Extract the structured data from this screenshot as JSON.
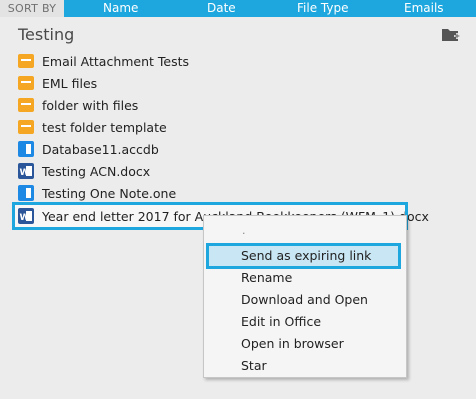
{
  "sort_bar": {
    "label": "SORT BY",
    "columns": [
      "Name",
      "Date",
      "File Type",
      "Emails"
    ]
  },
  "folder": {
    "title": "Testing",
    "new_folder_icon": "new-folder-icon"
  },
  "items": [
    {
      "name": "Email Attachment Tests",
      "type": "folder"
    },
    {
      "name": "EML files",
      "type": "folder"
    },
    {
      "name": "folder with files",
      "type": "folder"
    },
    {
      "name": "test folder template",
      "type": "folder"
    },
    {
      "name": "Database11.accdb",
      "type": "generic-file"
    },
    {
      "name": "Testing ACN.docx",
      "type": "word-file"
    },
    {
      "name": "Testing One Note.one",
      "type": "generic-file"
    },
    {
      "name": "Year end letter 2017 for Auckland Bookkeepers (WFM_1).docx",
      "type": "word-file",
      "selected": true
    }
  ],
  "context_menu": {
    "overflow": ".",
    "items": [
      {
        "label": "Send as expiring link",
        "highlighted": true
      },
      {
        "label": "Rename"
      },
      {
        "label": "Download and Open"
      },
      {
        "label": "Edit in Office"
      },
      {
        "label": "Open in browser"
      },
      {
        "label": "Star"
      }
    ]
  },
  "colors": {
    "accent": "#1ea7de",
    "folder": "#f5a623",
    "word": "#2b579a",
    "file": "#2196f3"
  }
}
